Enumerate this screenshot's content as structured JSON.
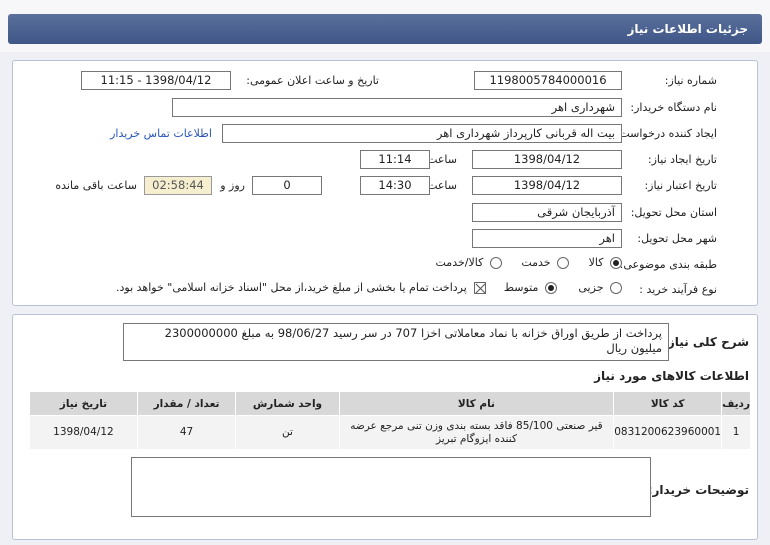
{
  "header": {
    "title": "جزئیات اطلاعات نیاز"
  },
  "form": {
    "need_number_label": "شماره نیاز:",
    "need_number": "1198005784000016",
    "announce_label": "تاریخ و ساعت اعلان عمومی:",
    "announce_value": "1398/04/12 - 11:15",
    "buyer_org_label": "نام دستگاه خریدار:",
    "buyer_org": "شهرداری اهر",
    "requester_label": "ایجاد کننده درخواست:",
    "requester": "بیت اله قربانی کارپرداز شهرداری اهر",
    "contact_link": "اطلاعات تماس خریدار",
    "created_label": "تاریخ ایجاد نیاز:",
    "created_date": "1398/04/12",
    "time_label": "ساعت",
    "created_time": "11:14",
    "valid_label": "تاریخ اعتبار نیاز:",
    "valid_date": "1398/04/12",
    "valid_time": "14:30",
    "days_label": "روز و",
    "days_value": "0",
    "remaining_value": "02:58:44",
    "remaining_label": "ساعت باقی مانده",
    "province_label": "استان محل تحویل:",
    "province": "آذربایجان شرقی",
    "city_label": "شهر محل تحویل:",
    "city": "اهر",
    "category_label": "طبقه بندی موضوعی:",
    "category_options": [
      "کالا",
      "خدمت",
      "کالا/خدمت"
    ],
    "purchase_label": "نوع فرآیند خرید :",
    "purchase_options": [
      "جزیی",
      "متوسط"
    ],
    "treasury_note": "پرداخت تمام یا بخشی از مبلغ خرید،از محل \"اسناد خزانه اسلامی\" خواهد بود."
  },
  "summary": {
    "label": "شرح کلی نیاز:",
    "text": "پرداخت از طریق اوراق خزانه با نماد معاملاتی اخزا 707 در سر رسید 98/06/27 به مبلغ 2300000000 میلیون ریال"
  },
  "goods": {
    "title": "اطلاعات کالاهای مورد نیاز",
    "headers": [
      "ردیف",
      "کد کالا",
      "نام کالا",
      "واحد شمارش",
      "تعداد / مقدار",
      "تاریخ نیاز"
    ],
    "rows": [
      [
        "1",
        "0831200623960001",
        "قیر صنعتی 85/100 فاقد بسته بندی وزن تنی مرجع عرضه کننده ایزوگام تبریز",
        "تن",
        "47",
        "1398/04/12"
      ]
    ]
  },
  "buyer_notes": {
    "label": "توضیحات خریدار:",
    "text": ""
  }
}
